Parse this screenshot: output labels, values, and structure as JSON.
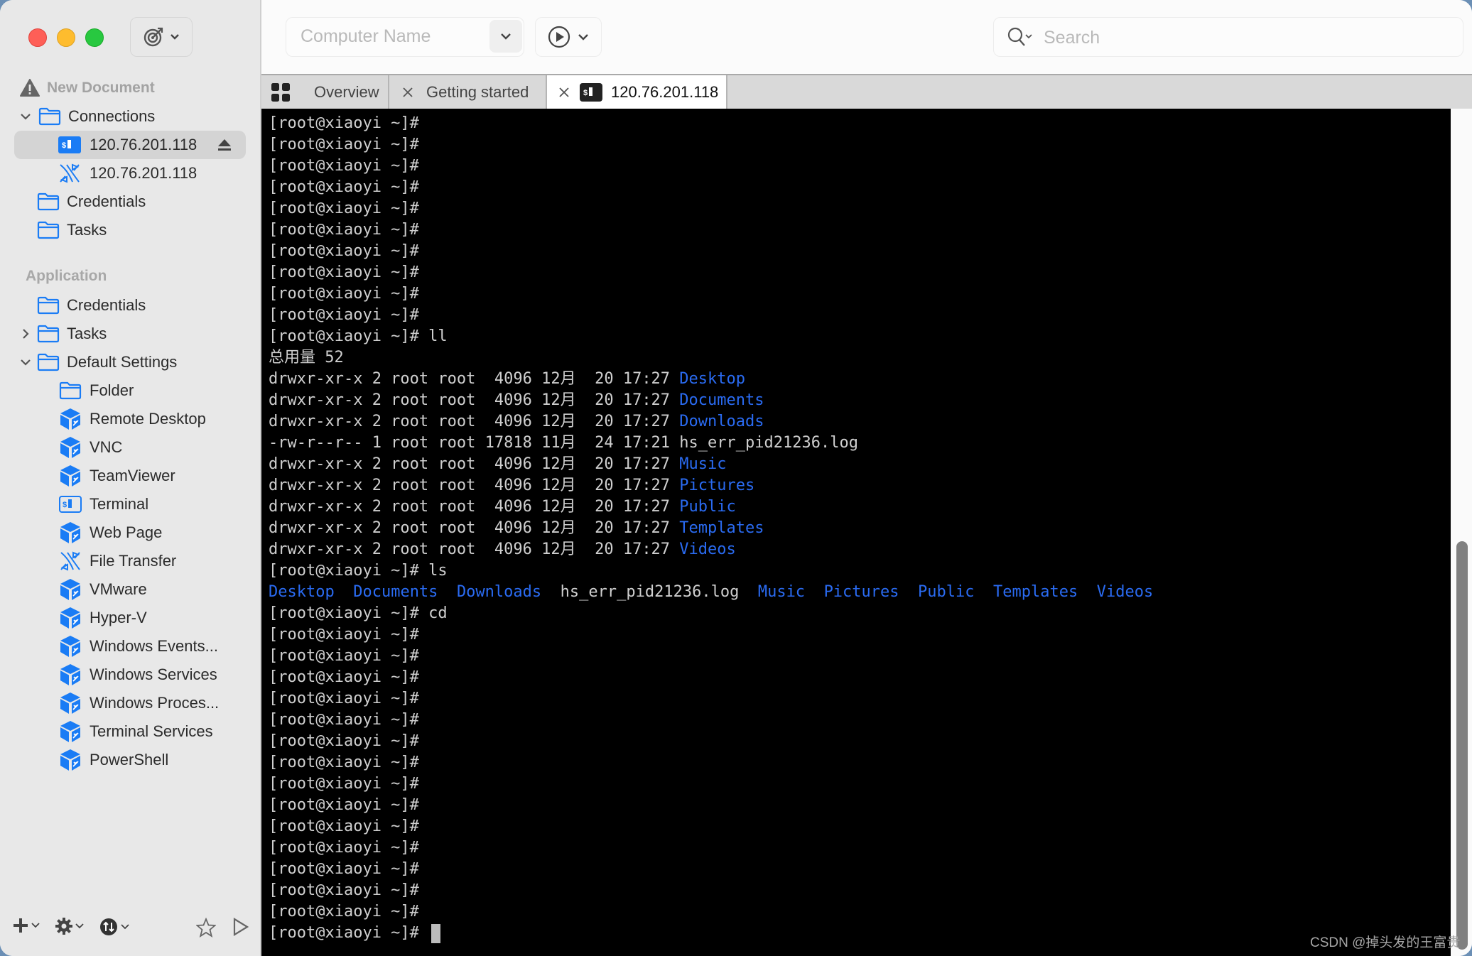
{
  "sidebar": {
    "top_button_icon": "target-icon",
    "document": {
      "label": "New Document",
      "icon": "warning-icon"
    },
    "connections": {
      "label": "Connections",
      "items": [
        {
          "label": "120.76.201.118",
          "icon": "terminal-icon",
          "selected": true,
          "trailing_icon": "eject-icon"
        },
        {
          "label": "120.76.201.118",
          "icon": "file-transfer-icon",
          "selected": false
        }
      ]
    },
    "doc_folders": [
      {
        "label": "Credentials",
        "icon": "folder-icon"
      },
      {
        "label": "Tasks",
        "icon": "folder-icon"
      }
    ],
    "application_section": "Application",
    "app_folders": [
      {
        "label": "Credentials",
        "icon": "folder-icon",
        "expander": ""
      },
      {
        "label": "Tasks",
        "icon": "folder-icon",
        "expander": "collapsed"
      },
      {
        "label": "Default Settings",
        "icon": "folder-icon",
        "expander": "expanded"
      }
    ],
    "default_settings_items": [
      {
        "label": "Folder",
        "icon": "folder-icon"
      },
      {
        "label": "Remote Desktop",
        "icon": "plugin-cube-icon"
      },
      {
        "label": "VNC",
        "icon": "plugin-cube-icon"
      },
      {
        "label": "TeamViewer",
        "icon": "plugin-cube-icon"
      },
      {
        "label": "Terminal",
        "icon": "terminal-icon"
      },
      {
        "label": "Web Page",
        "icon": "plugin-cube-icon"
      },
      {
        "label": "File Transfer",
        "icon": "file-transfer-icon"
      },
      {
        "label": "VMware",
        "icon": "plugin-cube-icon"
      },
      {
        "label": "Hyper-V",
        "icon": "plugin-cube-icon"
      },
      {
        "label": "Windows Events...",
        "icon": "plugin-cube-icon"
      },
      {
        "label": "Windows Services",
        "icon": "plugin-cube-icon"
      },
      {
        "label": "Windows Proces...",
        "icon": "plugin-cube-icon"
      },
      {
        "label": "Terminal Services",
        "icon": "plugin-cube-icon"
      },
      {
        "label": "PowerShell",
        "icon": "plugin-cube-icon"
      }
    ],
    "bottom_buttons": [
      "add-icon",
      "gear-icon",
      "sync-icon",
      "star-icon",
      "play-icon"
    ]
  },
  "toolbar": {
    "computer_name_placeholder": "Computer Name",
    "search_placeholder": "Search"
  },
  "tabs": [
    {
      "label": "Overview",
      "icon": "grid-icon",
      "active": false
    },
    {
      "label": "Getting started",
      "icon": "close-icon",
      "active": false
    },
    {
      "label": "120.76.201.118",
      "icon": "terminal-icon",
      "active": true
    }
  ],
  "terminal": {
    "prompt": "[root@xiaoyi ~]#",
    "lines": [
      {
        "text": "[root@xiaoyi ~]#"
      },
      {
        "text": "[root@xiaoyi ~]#"
      },
      {
        "text": "[root@xiaoyi ~]#"
      },
      {
        "text": "[root@xiaoyi ~]#"
      },
      {
        "text": "[root@xiaoyi ~]#"
      },
      {
        "text": "[root@xiaoyi ~]#"
      },
      {
        "text": "[root@xiaoyi ~]#"
      },
      {
        "text": "[root@xiaoyi ~]#"
      },
      {
        "text": "[root@xiaoyi ~]#"
      },
      {
        "text": "[root@xiaoyi ~]#"
      },
      {
        "text": "[root@xiaoyi ~]# ll"
      },
      {
        "text": "总用量 52"
      },
      {
        "text": "drwxr-xr-x 2 root root  4096 12月  20 17:27 ",
        "name": "Desktop",
        "dir": true
      },
      {
        "text": "drwxr-xr-x 2 root root  4096 12月  20 17:27 ",
        "name": "Documents",
        "dir": true
      },
      {
        "text": "drwxr-xr-x 2 root root  4096 12月  20 17:27 ",
        "name": "Downloads",
        "dir": true
      },
      {
        "text": "-rw-r--r-- 1 root root 17818 11月  24 17:21 ",
        "name": "hs_err_pid21236.log",
        "dir": false
      },
      {
        "text": "drwxr-xr-x 2 root root  4096 12月  20 17:27 ",
        "name": "Music",
        "dir": true
      },
      {
        "text": "drwxr-xr-x 2 root root  4096 12月  20 17:27 ",
        "name": "Pictures",
        "dir": true
      },
      {
        "text": "drwxr-xr-x 2 root root  4096 12月  20 17:27 ",
        "name": "Public",
        "dir": true
      },
      {
        "text": "drwxr-xr-x 2 root root  4096 12月  20 17:27 ",
        "name": "Templates",
        "dir": true
      },
      {
        "text": "drwxr-xr-x 2 root root  4096 12月  20 17:27 ",
        "name": "Videos",
        "dir": true
      },
      {
        "text": "[root@xiaoyi ~]# ls"
      },
      {
        "ls": [
          {
            "name": "Desktop",
            "dir": true
          },
          {
            "name": "Documents",
            "dir": true
          },
          {
            "name": "Downloads",
            "dir": true
          },
          {
            "name": "hs_err_pid21236.log",
            "dir": false
          },
          {
            "name": "Music",
            "dir": true
          },
          {
            "name": "Pictures",
            "dir": true
          },
          {
            "name": "Public",
            "dir": true
          },
          {
            "name": "Templates",
            "dir": true
          },
          {
            "name": "Videos",
            "dir": true
          }
        ]
      },
      {
        "text": "[root@xiaoyi ~]# cd"
      },
      {
        "text": "[root@xiaoyi ~]#"
      },
      {
        "text": "[root@xiaoyi ~]#"
      },
      {
        "text": "[root@xiaoyi ~]#"
      },
      {
        "text": "[root@xiaoyi ~]#"
      },
      {
        "text": "[root@xiaoyi ~]#"
      },
      {
        "text": "[root@xiaoyi ~]#"
      },
      {
        "text": "[root@xiaoyi ~]#"
      },
      {
        "text": "[root@xiaoyi ~]#"
      },
      {
        "text": "[root@xiaoyi ~]#"
      },
      {
        "text": "[root@xiaoyi ~]#"
      },
      {
        "text": "[root@xiaoyi ~]#"
      },
      {
        "text": "[root@xiaoyi ~]#"
      },
      {
        "text": "[root@xiaoyi ~]#"
      },
      {
        "text": "[root@xiaoyi ~]#"
      },
      {
        "text": "[root@xiaoyi ~]# ",
        "cursor": true
      }
    ],
    "colors": {
      "text": "#cfcfcf",
      "directory": "#2a6bf2",
      "background": "#000000"
    }
  },
  "watermark": "CSDN @掉头发的王富贵",
  "accent_color": "#1a7cf5"
}
